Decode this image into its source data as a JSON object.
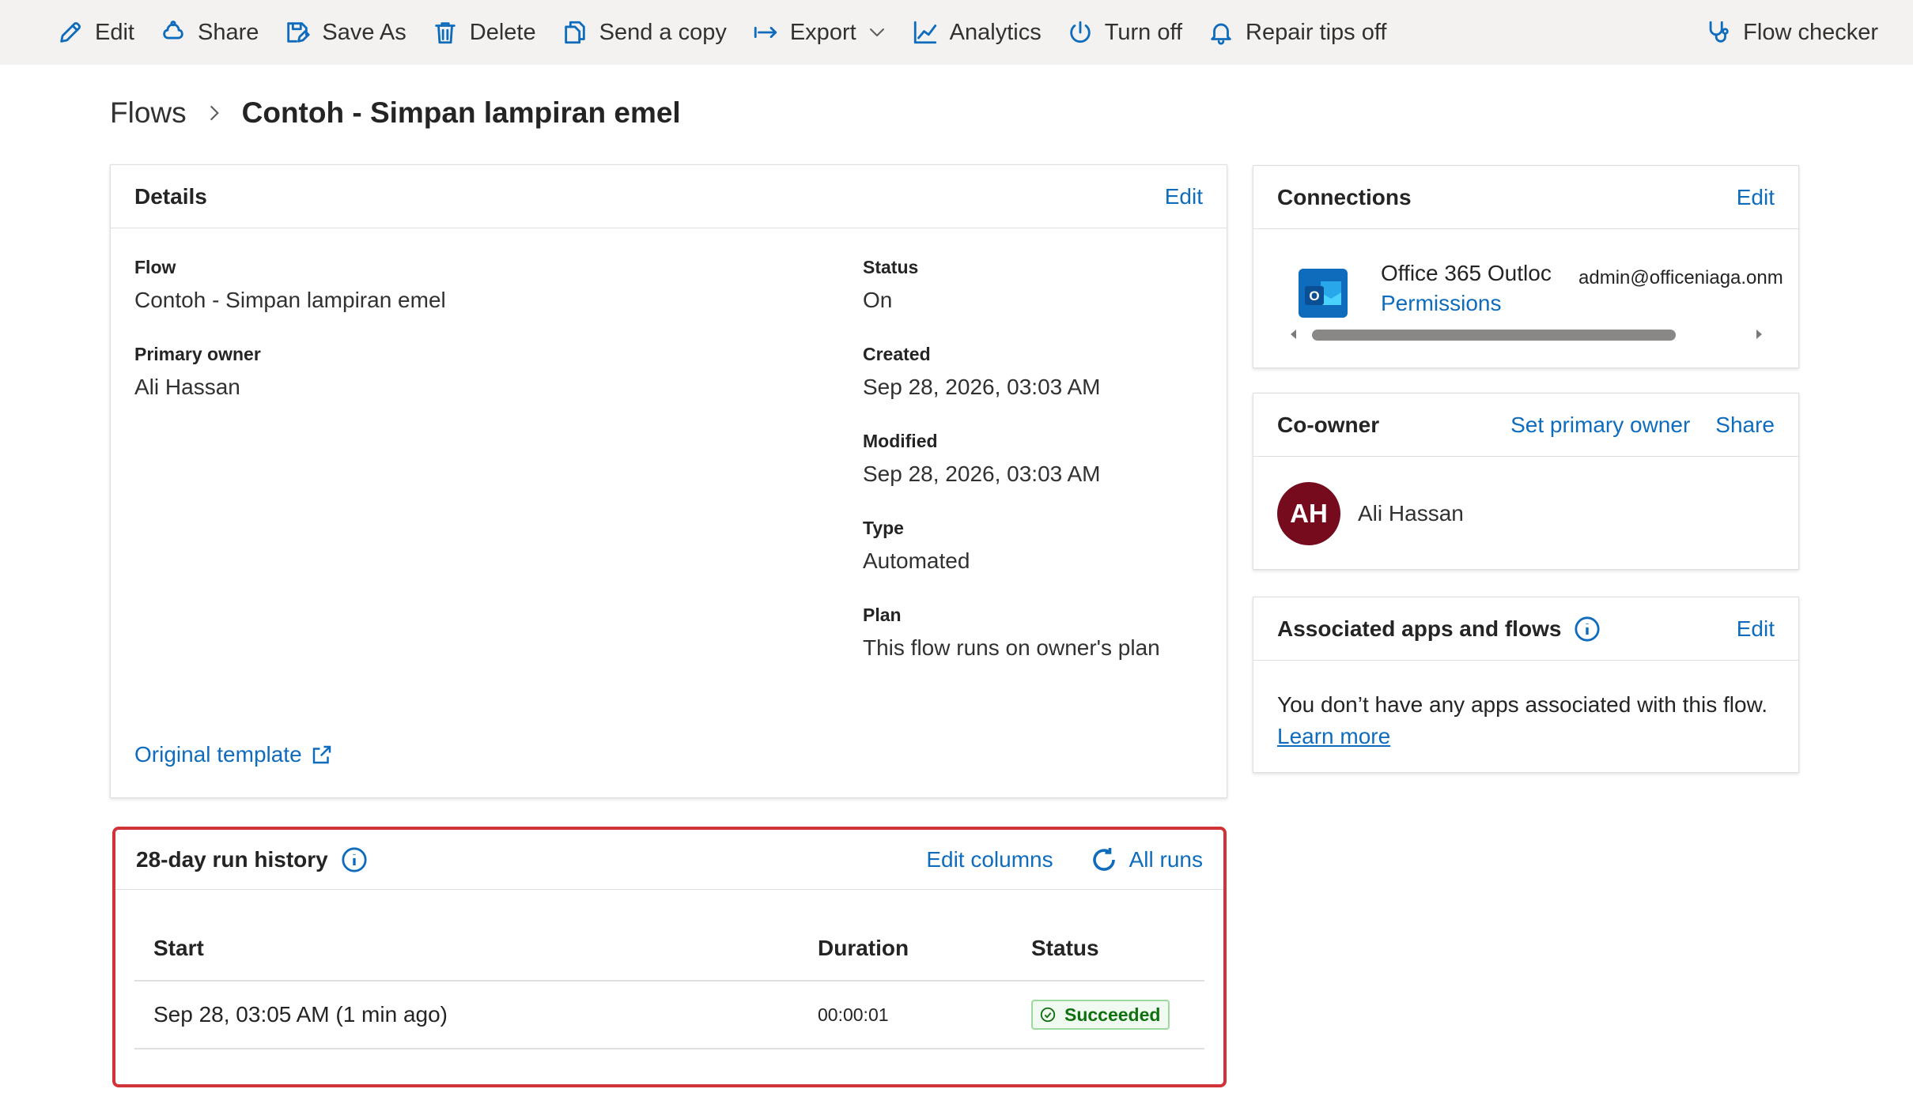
{
  "toolbar": {
    "edit": "Edit",
    "share": "Share",
    "save_as": "Save As",
    "delete": "Delete",
    "send_copy": "Send a copy",
    "export": "Export",
    "analytics": "Analytics",
    "turn_off": "Turn off",
    "repair_tips": "Repair tips off",
    "flow_checker": "Flow checker"
  },
  "breadcrumb": {
    "root": "Flows",
    "current": "Contoh - Simpan lampiran emel"
  },
  "details": {
    "title": "Details",
    "edit": "Edit",
    "flow_label": "Flow",
    "flow_value": "Contoh - Simpan lampiran emel",
    "owner_label": "Primary owner",
    "owner_value": "Ali Hassan",
    "status_label": "Status",
    "status_value": "On",
    "created_label": "Created",
    "created_value": "Sep 28, 2026, 03:03 AM",
    "modified_label": "Modified",
    "modified_value": "Sep 28, 2026, 03:03 AM",
    "type_label": "Type",
    "type_value": "Automated",
    "plan_label": "Plan",
    "plan_value": "This flow runs on owner's plan",
    "original_template": "Original template"
  },
  "connections": {
    "title": "Connections",
    "edit": "Edit",
    "items": [
      {
        "name": "Office 365 Outloc",
        "permissions": "Permissions",
        "email": "admin@officeniaga.onm",
        "icon": "outlook-icon"
      }
    ]
  },
  "coowner": {
    "title": "Co-owner",
    "set_primary": "Set primary owner",
    "share": "Share",
    "owner_initials": "AH",
    "owner_name": "Ali Hassan"
  },
  "associated": {
    "title": "Associated apps and flows",
    "edit": "Edit",
    "message": "You don’t have any apps associated with this flow.",
    "learn_more": "Learn more"
  },
  "run_history": {
    "title": "28-day run history",
    "edit_columns": "Edit columns",
    "all_runs": "All runs",
    "columns": {
      "start": "Start",
      "duration": "Duration",
      "status": "Status"
    },
    "rows": [
      {
        "start": "Sep 28, 03:05 AM (1 min ago)",
        "duration": "00:00:01",
        "status": "Succeeded"
      }
    ]
  },
  "colors": {
    "accent": "#0f6cbd",
    "highlight_border": "#d13438",
    "success": "#0e700e",
    "avatar_bg": "#750b1c"
  }
}
